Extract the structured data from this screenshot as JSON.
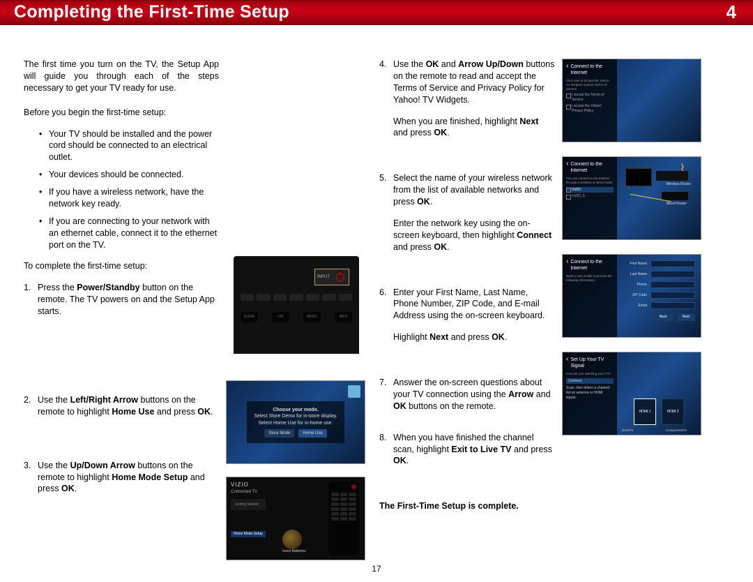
{
  "header": {
    "title": "Completing the First-Time Setup",
    "chapter": "4"
  },
  "intro": "The first time you turn on the TV, the Setup App will guide you through each of the steps necessary to get your TV ready for use.",
  "before_label": "Before you begin the first-time setup:",
  "bullets": {
    "b1": "Your TV should be installed and the power cord should be connected to an electrical outlet.",
    "b2": "Your devices should be connected.",
    "b3": "If you have a wireless network, have the network key ready.",
    "b4": "If you are connecting to your network with an ethernet cable, connect it to the ethernet port on the TV."
  },
  "complete_label": "To complete the first-time setup:",
  "steps": {
    "s1a": "Press the ",
    "s1b": "Power/Standby",
    "s1c": " button on the remote. The TV powers on and the Setup App starts.",
    "s2a": "Use the ",
    "s2b": "Left/Right Arrow",
    "s2c": " buttons on the remote to highlight ",
    "s2d": "Home Use",
    "s2e": " and press ",
    "s2f": "OK",
    "s2g": ".",
    "s3a": "Use the ",
    "s3b": "Up/Down Arrow",
    "s3c": " buttons on the remote to highlight ",
    "s3d": "Home Mode Setup",
    "s3e": " and press ",
    "s3f": "OK",
    "s3g": ".",
    "s4a": "Use the ",
    "s4b": "OK",
    "s4c": " and ",
    "s4d": "Arrow Up/Down",
    "s4e": " buttons on the remote to read and accept the Terms of Service and Privacy Policy for Yahoo! TV Widgets.",
    "s4f": "When you are finished, highlight ",
    "s4g": "Next",
    "s4h": " and press ",
    "s4i": "OK",
    "s4j": ".",
    "s5a": "Select the name of your wireless network from the list of available networks and press ",
    "s5b": "OK",
    "s5c": ".",
    "s5d": "Enter the network key using the on-screen keyboard, then highlight ",
    "s5e": "Connect",
    "s5f": " and press ",
    "s5g": "OK",
    "s5h": ".",
    "s6a": "Enter your First Name, Last Name, Phone Number, ZIP Code, and E-mail Address using the on-screen keyboard.",
    "s6b": "Highlight ",
    "s6c": "Next",
    "s6d": " and press ",
    "s6e": "OK",
    "s6f": ".",
    "s7a": "Answer the on-screen questions about your TV connection using the ",
    "s7b": "Arrow",
    "s7c": " and ",
    "s7d": "OK",
    "s7e": " buttons on the remote.",
    "s8a": "When you have finished the channel scan, highlight ",
    "s8b": "Exit to Live TV",
    "s8c": " and press ",
    "s8d": "OK",
    "s8e": "."
  },
  "fig_mode": {
    "title": "Choose your mode.",
    "l1": "Select Store Demo for in-store display.",
    "l2": "Select Home Use for in-home use.",
    "btn1": "Store Mode",
    "btn2": "Home Use"
  },
  "fig_home": {
    "brand": "VIZIO",
    "sub": "Connected TV",
    "menu_hdr": "Getting Started",
    "hl": "Home Mode Setup",
    "batt": "Insert Batteries"
  },
  "thumb_tos": {
    "title": "Connect to the Internet",
    "o1": "I accept the Terms of Service",
    "o2": "I accept the Yahoo! Privacy Policy"
  },
  "thumb_net": {
    "title": "Connect to the Internet",
    "wr": "Wireless Router",
    "wd": "Wired Router",
    "o1": "VIZIO",
    "o2": "VIZIO_5"
  },
  "thumb_form": {
    "title": "Connect to the Internet",
    "back": "Back",
    "next": "Next"
  },
  "thumb_sig": {
    "title": "Set Up Your TV Signal",
    "cont": "Continue",
    "h1": "HDMI 1",
    "h2": "HDMI 2",
    "sub1": "DVD/TV",
    "sub2": "Component/AV"
  },
  "remote": {
    "input": "INPUT",
    "guide": "GUIDE",
    "via": "VIA",
    "menu": "MENU",
    "info": "INFO"
  },
  "complete": "The First-Time Setup is complete.",
  "page_num": "17"
}
